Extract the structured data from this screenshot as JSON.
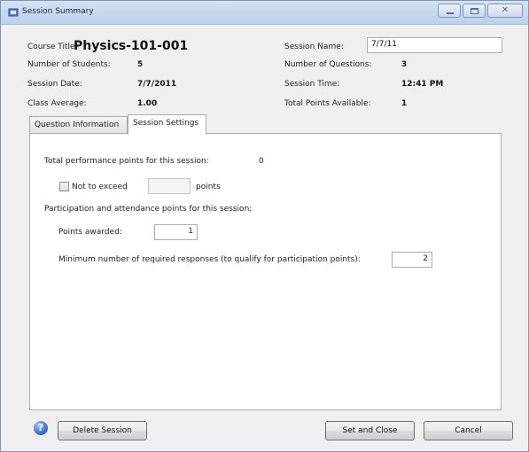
{
  "window": {
    "title": "Session Summary",
    "controls": {
      "minimize": "",
      "maximize": "",
      "close": "✕"
    }
  },
  "header": {
    "course_title_label": "Course Title:",
    "course_title_value": "Physics-101-001",
    "num_students_label": "Number of Students:",
    "num_students_value": "5",
    "session_date_label": "Session Date:",
    "session_date_value": "7/7/2011",
    "class_average_label": "Class Average:",
    "class_average_value": "1.00",
    "session_name_label": "Session Name:",
    "session_name_value": "7/7/11",
    "num_questions_label": "Number of Questions:",
    "num_questions_value": "3",
    "session_time_label": "Session Time:",
    "session_time_value": "12:41 PM",
    "total_points_label": "Total Points Available:",
    "total_points_value": "1"
  },
  "tabs": [
    {
      "label": "Question Information",
      "active": false
    },
    {
      "label": "Session Settings",
      "active": true
    }
  ],
  "settings": {
    "total_performance_label": "Total performance points for this session:",
    "total_performance_value": "0",
    "not_to_exceed_label": "Not to exceed",
    "not_to_exceed_checked": false,
    "not_to_exceed_value": "",
    "points_suffix": "points",
    "participation_label": "Participation and attendance points for this session:",
    "points_awarded_label": "Points awarded:",
    "points_awarded_value": "1",
    "min_responses_label": "Minimum number of required responses (to qualify for participation points):",
    "min_responses_value": "2"
  },
  "footer": {
    "help_glyph": "?",
    "delete_label": "Delete Session",
    "set_close_label": "Set and Close",
    "cancel_label": "Cancel"
  },
  "colors": {
    "titlebar": "#c8d9ef",
    "panel_bg": "#ffffff",
    "window_bg": "#f0f0f0",
    "help_icon": "#2f64c6"
  }
}
